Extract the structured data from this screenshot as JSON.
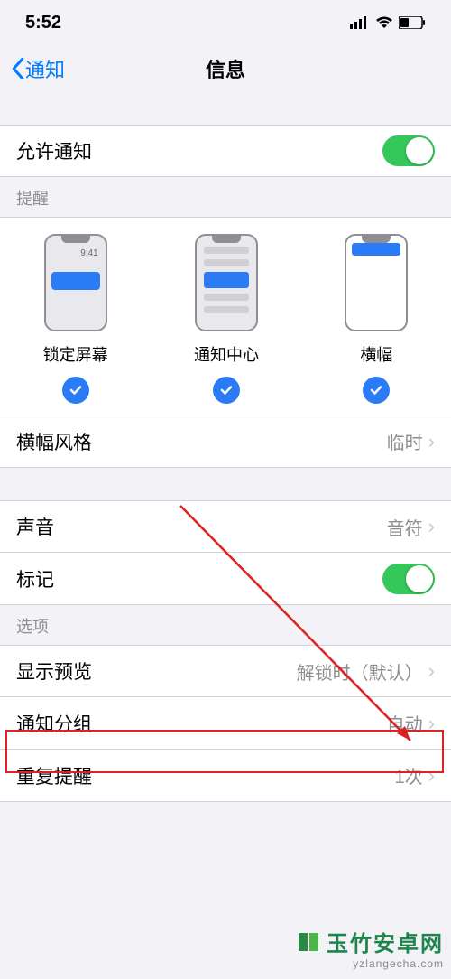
{
  "status": {
    "time": "5:52"
  },
  "nav": {
    "back_label": "通知",
    "title": "信息"
  },
  "allow": {
    "label": "允许通知"
  },
  "alerts": {
    "header": "提醒",
    "lock_screen": {
      "label": "锁定屏幕",
      "time": "9:41"
    },
    "notification_center": {
      "label": "通知中心"
    },
    "banners": {
      "label": "横幅"
    },
    "style_row": {
      "label": "横幅风格",
      "value": "临时"
    }
  },
  "sounds_row": {
    "label": "声音",
    "value": "音符"
  },
  "badges_row": {
    "label": "标记"
  },
  "options": {
    "header": "选项",
    "preview": {
      "label": "显示预览",
      "value": "解锁时（默认）"
    },
    "grouping": {
      "label": "通知分组",
      "value": "自动"
    },
    "repeat": {
      "label": "重复提醒",
      "value": "1次"
    }
  },
  "watermark": {
    "brand": "玉竹安卓网",
    "url": "yzlangecha.com"
  }
}
